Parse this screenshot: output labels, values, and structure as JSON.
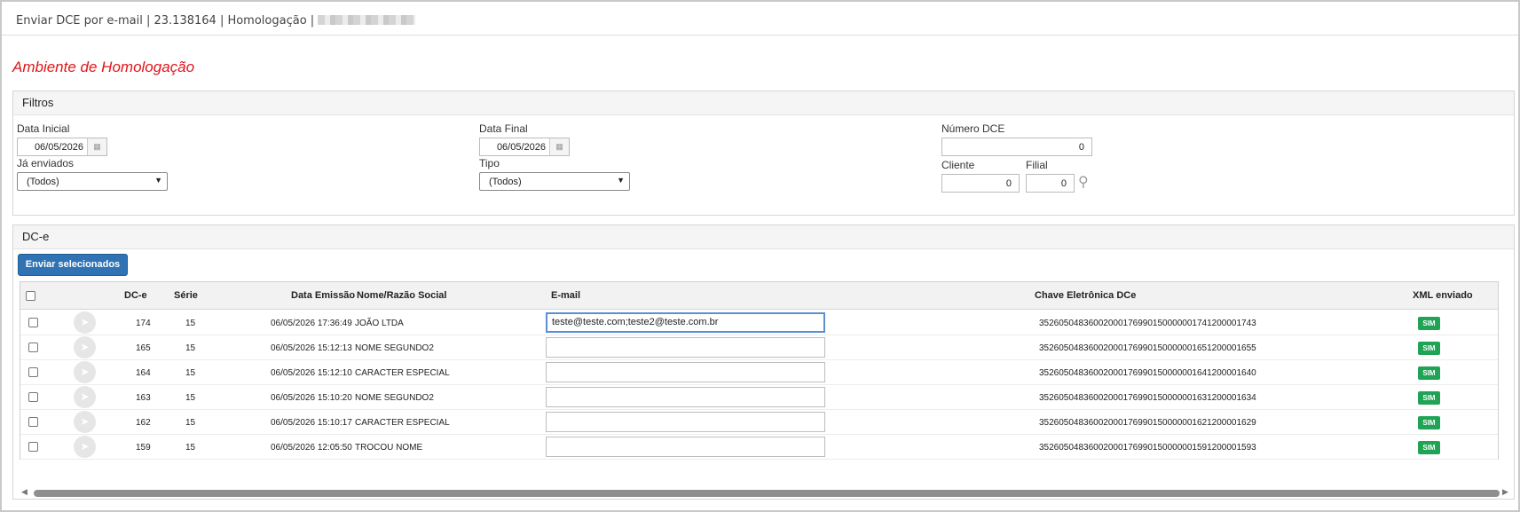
{
  "title_bar": {
    "text": "Enviar DCE por e-mail | 23.138164 | Homologação |"
  },
  "environment_label": "Ambiente de Homologação",
  "filters": {
    "heading": "Filtros",
    "data_inicial": {
      "label": "Data Inicial",
      "value": "06/05/2026"
    },
    "data_final": {
      "label": "Data Final",
      "value": "06/05/2026"
    },
    "numero_dce": {
      "label": "Número DCE",
      "value": "0"
    },
    "ja_enviados": {
      "label": "Já enviados",
      "value": "(Todos)"
    },
    "tipo": {
      "label": "Tipo",
      "value": "(Todos)"
    },
    "cliente": {
      "label": "Cliente",
      "value": "0"
    },
    "filial": {
      "label": "Filial",
      "value": "0"
    }
  },
  "dce_panel": {
    "heading": "DC-e",
    "send_button": "Enviar selecionados",
    "columns": {
      "dce": "DC-e",
      "serie": "Série",
      "data_emissao": "Data Emissão",
      "nome": "Nome/Razão Social",
      "email": "E-mail",
      "chave": "Chave Eletrônica DCe",
      "xml": "XML enviado"
    },
    "rows": [
      {
        "dce": "174",
        "serie": "15",
        "data": "06/05/2026 17:36:49",
        "nome": "JOÃO LTDA",
        "email": "teste@teste.com;teste2@teste.com.br",
        "chave": "35260504836002000176990150000001741200001743",
        "xml": "SIM"
      },
      {
        "dce": "165",
        "serie": "15",
        "data": "06/05/2026 15:12:13",
        "nome": "NOME SEGUNDO2",
        "email": "",
        "chave": "35260504836002000176990150000001651200001655",
        "xml": "SIM"
      },
      {
        "dce": "164",
        "serie": "15",
        "data": "06/05/2026 15:12:10",
        "nome": "CARACTER ESPECIAL",
        "email": "",
        "chave": "35260504836002000176990150000001641200001640",
        "xml": "SIM"
      },
      {
        "dce": "163",
        "serie": "15",
        "data": "06/05/2026 15:10:20",
        "nome": "NOME SEGUNDO2",
        "email": "",
        "chave": "35260504836002000176990150000001631200001634",
        "xml": "SIM"
      },
      {
        "dce": "162",
        "serie": "15",
        "data": "06/05/2026 15:10:17",
        "nome": "CARACTER ESPECIAL",
        "email": "",
        "chave": "35260504836002000176990150000001621200001629",
        "xml": "SIM"
      },
      {
        "dce": "159",
        "serie": "15",
        "data": "06/05/2026 12:05:50",
        "nome": "TROCOU NOME",
        "email": "",
        "chave": "35260504836002000176990150000001591200001593",
        "xml": "SIM"
      }
    ]
  },
  "colors": {
    "env_red": "#e0161b",
    "button_blue": "#2f73b4",
    "badge_green": "#1fa354"
  }
}
